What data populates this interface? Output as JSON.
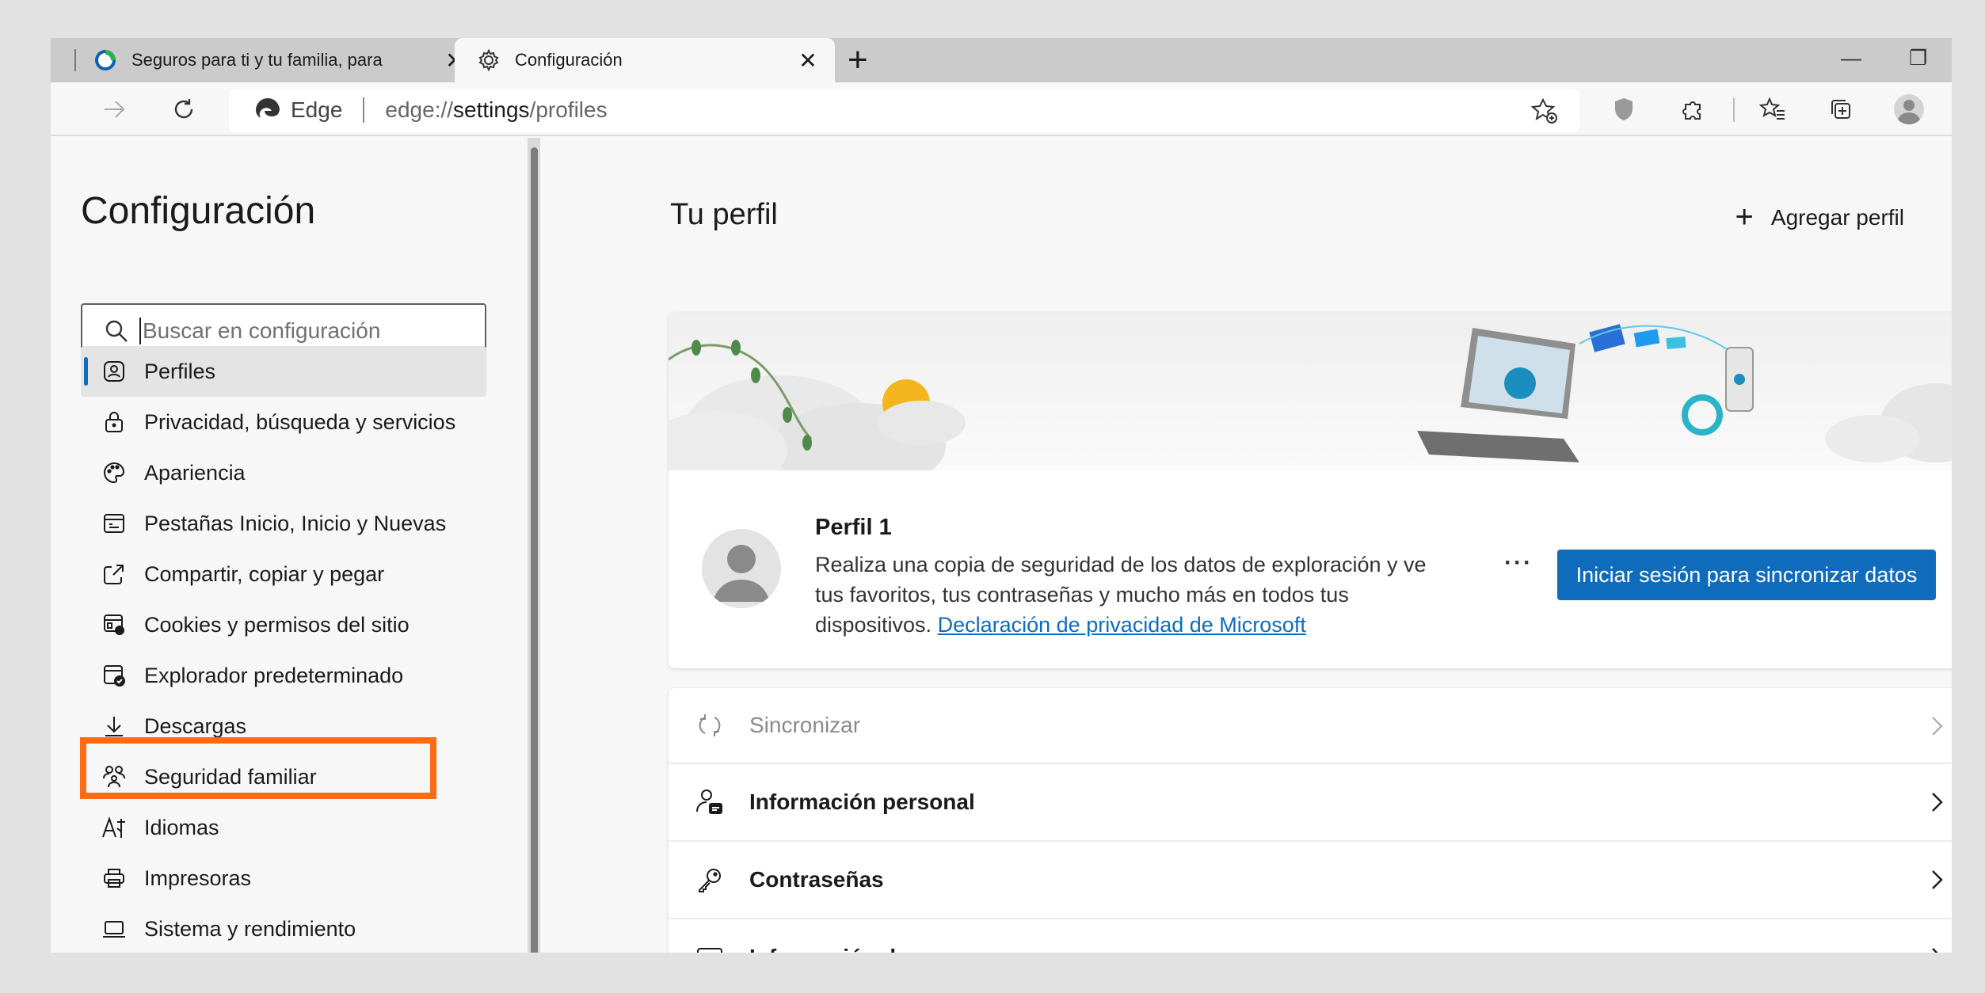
{
  "tabs": [
    {
      "title": "Seguros para ti y tu familia, para",
      "close": "✕"
    },
    {
      "title": "Configuración",
      "close": "✕"
    }
  ],
  "new_tab_label": "+",
  "window": {
    "minimize": "—",
    "restore": "❐"
  },
  "address_bar": {
    "browser_label": "Edge",
    "url_prefix": "edge://",
    "url_bold": "settings",
    "url_suffix": "/profiles"
  },
  "sidebar": {
    "title": "Configuración",
    "search_placeholder": "Buscar en configuración",
    "items": [
      {
        "label": "Perfiles",
        "icon": "profile-icon",
        "active": true
      },
      {
        "label": "Privacidad, búsqueda y servicios",
        "icon": "lock-icon"
      },
      {
        "label": "Apariencia",
        "icon": "palette-icon"
      },
      {
        "label": "Pestañas Inicio, Inicio y Nuevas",
        "icon": "start-page-icon"
      },
      {
        "label": "Compartir, copiar y pegar",
        "icon": "share-icon"
      },
      {
        "label": "Cookies y permisos del sitio",
        "icon": "cookies-icon"
      },
      {
        "label": "Explorador predeterminado",
        "icon": "default-browser-icon",
        "highlighted": true
      },
      {
        "label": "Descargas",
        "icon": "download-icon"
      },
      {
        "label": "Seguridad familiar",
        "icon": "family-icon"
      },
      {
        "label": "Idiomas",
        "icon": "language-icon"
      },
      {
        "label": "Impresoras",
        "icon": "printer-icon"
      },
      {
        "label": "Sistema y rendimiento",
        "icon": "laptop-icon"
      }
    ]
  },
  "main": {
    "title": "Tu perfil",
    "add_profile": "Agregar perfil",
    "profile": {
      "name": "Perfil 1",
      "description": "Realiza una copia de seguridad de los datos de exploración y ve tus favoritos, tus contraseñas y mucho más en todos tus dispositivos.",
      "link": "Declaración de privacidad de Microsoft",
      "more": "···",
      "signin_button": "Iniciar sesión para sincronizar datos"
    },
    "rows": [
      {
        "label": "Sincronizar",
        "icon": "sync-icon",
        "disabled": true
      },
      {
        "label": "Información personal",
        "icon": "personal-info-icon"
      },
      {
        "label": "Contraseñas",
        "icon": "key-icon"
      },
      {
        "label": "Información de pago",
        "icon": "credit-card-icon"
      }
    ]
  },
  "colors": {
    "accent": "#0f6cbd",
    "highlight": "#ff6a13"
  }
}
